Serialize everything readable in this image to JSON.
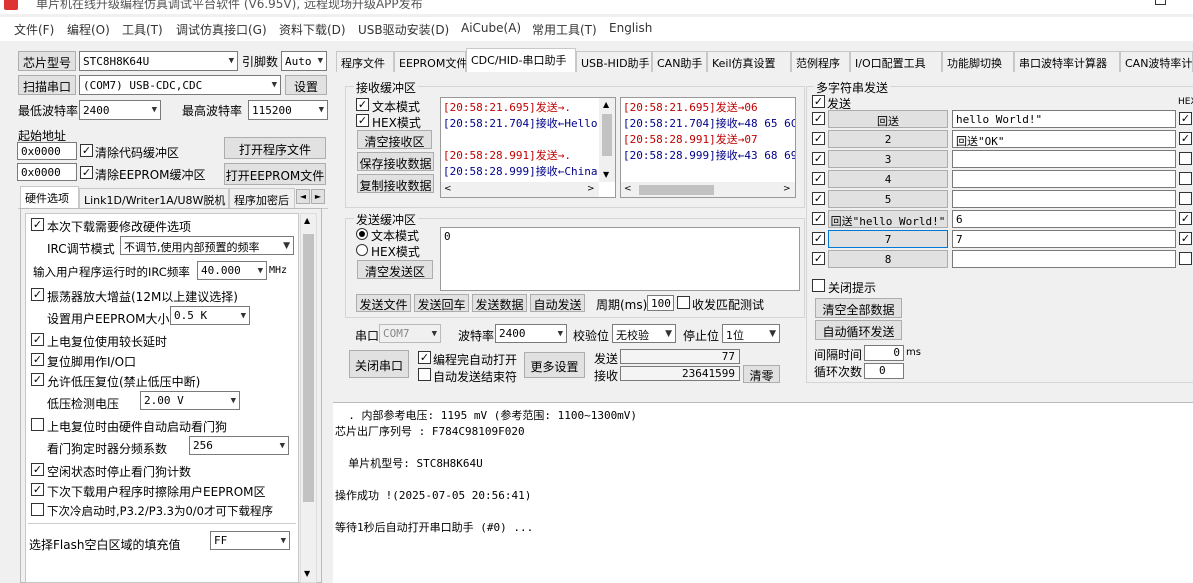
{
  "titlebar": {
    "title": "单片机在线升级编程仿真调试平台软件 (V6.95V), 远程现场升级APP发布"
  },
  "menu": [
    "文件(F)",
    "编程(O)",
    "工具(T)",
    "调试仿真接口(G)",
    "资料下载(D)",
    "USB驱动安装(D)",
    "AiCube(A)",
    "常用工具(T)",
    "English"
  ],
  "left": {
    "chip_btn": "芯片型号",
    "chip_value": "STC8H8K64U",
    "pin_label": "引脚数",
    "pin_value": "Auto",
    "scan_btn": "扫描串口",
    "port_value": "(COM7) USB-CDC,CDC",
    "settings_btn": "设置",
    "min_baud_label": "最低波特率",
    "min_baud_value": "2400",
    "max_baud_label": "最高波特率",
    "max_baud_value": "115200",
    "start_addr_label": "起始地址",
    "addr1": "0x0000",
    "clear_code": "清除代码缓冲区",
    "open_prog": "打开程序文件",
    "addr2": "0x0000",
    "clear_eeprom": "清除EEPROM缓冲区",
    "open_eeprom": "打开EEPROM文件",
    "tabs": [
      "硬件选项",
      "Link1D/Writer1A/U8W脱机",
      "程序加密后"
    ],
    "options": {
      "o1": "本次下载需要修改硬件选项",
      "irc_label": "IRC调节模式",
      "irc_value": "不调节,使用内部预置的频率",
      "freq_label": "输入用户程序运行时的IRC频率",
      "freq_value": "40.000",
      "freq_unit": "MHz",
      "o2": "振荡器放大增益(12M以上建议选择)",
      "eeprom_size_label": "设置用户EEPROM大小",
      "eeprom_size_value": "0.5 K",
      "o3": "上电复位使用较长延时",
      "o4": "复位脚用作I/O口",
      "o5": "允许低压复位(禁止低压中断)",
      "lv_label": "低压检测电压",
      "lv_value": "2.00 V",
      "o6": "上电复位时由硬件自动启动看门狗",
      "wd_label": "看门狗定时器分频系数",
      "wd_value": "256",
      "o7": "空闲状态时停止看门狗计数",
      "o8": "下次下载用户程序时擦除用户EEPROM区",
      "o9": "下次冷启动时,P3.2/P3.3为0/0才可下载程序",
      "fill_label": "选择Flash空白区域的填充值",
      "fill_value": "FF"
    }
  },
  "right_tabs": [
    "程序文件",
    "EEPROM文件",
    "CDC/HID-串口助手",
    "USB-HID助手",
    "CAN助手",
    "Keil仿真设置",
    "范例程序",
    "I/O口配置工具",
    "功能脚切换",
    "串口波特率计算器",
    "CAN波特率计"
  ],
  "recv": {
    "group": "接收缓冲区",
    "text_mode": "文本模式",
    "hex_mode": "HEX模式",
    "clear": "清空接收区",
    "save": "保存接收数据",
    "copy": "复制接收数据",
    "left_log": [
      {
        "t": "[20:58:21.695]发送→.",
        "c": "red"
      },
      {
        "t": "[20:58:21.704]接收←Hello",
        "c": "blue"
      },
      {
        "t": "",
        "c": "blue"
      },
      {
        "t": "[20:58:28.991]发送→.",
        "c": "red"
      },
      {
        "t": "[20:58:28.999]接收←China",
        "c": "blue"
      }
    ],
    "right_log": [
      {
        "t": "[20:58:21.695]发送→06",
        "c": "red"
      },
      {
        "t": "[20:58:21.704]接收←48 65 6C",
        "c": "blue"
      },
      {
        "t": "[20:58:28.991]发送→07",
        "c": "red"
      },
      {
        "t": "[20:58:28.999]接收←43 68 69",
        "c": "blue"
      }
    ]
  },
  "send": {
    "group": "发送缓冲区",
    "text_mode": "文本模式",
    "hex_mode": "HEX模式",
    "clear": "清空发送区",
    "content": "0",
    "send_file": "发送文件",
    "send_enter": "发送回车",
    "send_data": "发送数据",
    "auto_send": "自动发送",
    "period_label": "周期(ms)",
    "period_value": "100",
    "match": "收发匹配测试",
    "port_label": "串口",
    "port_value": "COM7",
    "baud_label": "波特率",
    "baud_value": "2400",
    "parity_label": "校验位",
    "parity_value": "无校验",
    "stop_label": "停止位",
    "stop_value": "1位",
    "close_port": "关闭串口",
    "auto_open": "编程完自动打开",
    "auto_end": "自动发送结束符",
    "more": "更多设置",
    "sent_label": "发送",
    "sent_value": "77",
    "recv_label": "接收",
    "recv_value": "23641599",
    "clear_count": "清零"
  },
  "multi": {
    "group": "多字符串发送",
    "send_label": "发送",
    "hex_label": "HEX",
    "rows": [
      {
        "btn": "回送",
        "val": "hello World!\""
      },
      {
        "btn": "2",
        "val": "回送\"OK\""
      },
      {
        "btn": "3",
        "val": ""
      },
      {
        "btn": "4",
        "val": ""
      },
      {
        "btn": "5",
        "val": ""
      },
      {
        "btn": "回送\"hello World!\"",
        "val": "6"
      },
      {
        "btn": "7",
        "val": "7"
      },
      {
        "btn": "8",
        "val": ""
      }
    ],
    "close_tip": "关闭提示",
    "clear_all": "清空全部数据",
    "auto_loop": "自动循环发送",
    "interval_label": "间隔时间",
    "interval_value": "0",
    "interval_unit": "ms",
    "loop_label": "循环次数",
    "loop_value": "0"
  },
  "output": [
    "  . 内部参考电压: 1195 mV (参考范围: 1100~1300mV)",
    "芯片出厂序列号 : F784C98109F020",
    "",
    "  单片机型号: STC8H8K64U",
    "",
    "操作成功 !(2025-07-05 20:56:41)",
    "",
    "等待1秒后自动打开串口助手 (#0) ..."
  ]
}
